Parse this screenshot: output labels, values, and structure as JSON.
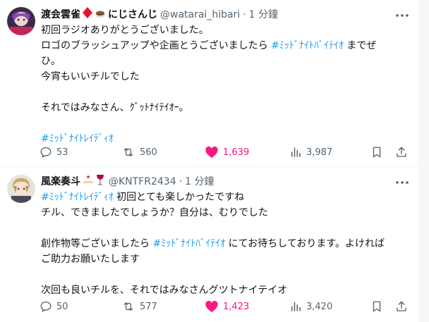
{
  "colors": {
    "link": "#1d9bf0",
    "like": "#f91880",
    "muted": "#536471",
    "text": "#0f1419"
  },
  "tweets": [
    {
      "name": "渡会雲雀",
      "emoji_icons": [
        "diamond-emoji-icon",
        "cup-emoji-icon"
      ],
      "org": "にじさんじ",
      "handle": "@watarai_hibari",
      "dot": "·",
      "time": "1 分鐘",
      "lines": [
        [
          "初回ラジオありがとうございました。"
        ],
        [
          "ロゴのブラッシュアップや企画とうございましたら ",
          "#ﾐｯﾄﾞﾅｲﾄﾊﾞｲﾃｲｵ",
          " までぜ"
        ],
        [
          "ひ。"
        ],
        [
          "今宵もいいチルでした"
        ],
        [
          ""
        ],
        [
          "それではみなさん、ｸﾞｯﾄﾅｲﾃｲｵｰ。"
        ],
        [
          ""
        ],
        [
          "",
          "#ﾐｯﾄﾞﾅｲﾄﾚｲﾃﾞｨｵ",
          ""
        ]
      ],
      "replies": "53",
      "retweets": "560",
      "likes": "1,639",
      "views": "3,987"
    },
    {
      "name": "風楽奏斗",
      "emoji_icons": [
        "cake-emoji-icon",
        "wine-glass-emoji-icon"
      ],
      "handle": "@KNTFR2434",
      "dot": "·",
      "time": "1 分鐘",
      "lines": [
        [
          "",
          "#ﾐｯﾄﾞﾅｲﾄﾚｲﾃﾞｨｵ",
          " 初回とても楽しかったですね"
        ],
        [
          "チル、できましたでしょうか？自分は、むりでした"
        ],
        [
          ""
        ],
        [
          "創作物等ございましたら ",
          "#ﾐｯﾄﾞﾅｲﾄﾊﾞｲﾃｲｵ",
          " にてお待ちしております。よければ"
        ],
        [
          "ご助力お願いたします"
        ],
        [
          ""
        ],
        [
          "次回も良いチルを、それではみなさんグツトナイテイオ"
        ]
      ],
      "replies": "50",
      "retweets": "577",
      "likes": "1,423",
      "views": "3,420"
    }
  ]
}
